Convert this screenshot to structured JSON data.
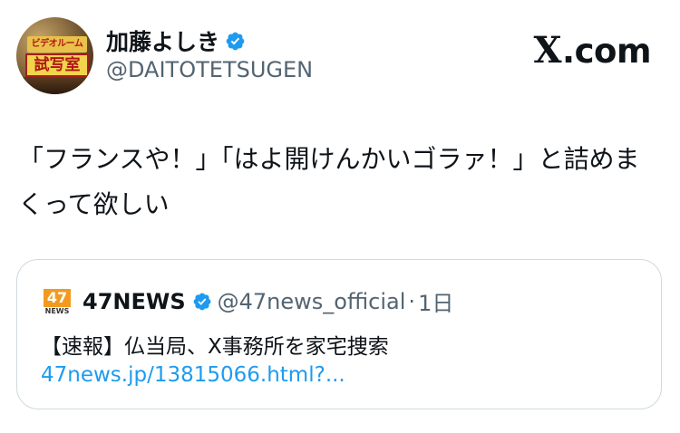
{
  "tweet": {
    "author": {
      "name": "加藤よしき",
      "handle": "@DAITOTETSUGEN",
      "avatar_sign_top": "ビデオルーム",
      "avatar_sign_main": "試写室"
    },
    "brand": {
      "mark": "X",
      "suffix": ".com"
    },
    "text": "「フランスや！」「はよ開けんかいゴラァ！」と詰めまくって欲しい",
    "quote": {
      "logo_number": "47",
      "logo_sub": "NEWS",
      "name": "47NEWS",
      "handle": "@47news_official",
      "separator": "·",
      "time": "1日",
      "text": "【速報】仏当局、X事務所を家宅捜索",
      "link": "47news.jp/13815066.html?..."
    }
  },
  "colors": {
    "verified_badge": "#1d9bf0",
    "link": "#1d9bf0",
    "secondary_text": "#536471",
    "primary_text": "#0f1419",
    "card_border": "#cfd9de"
  }
}
